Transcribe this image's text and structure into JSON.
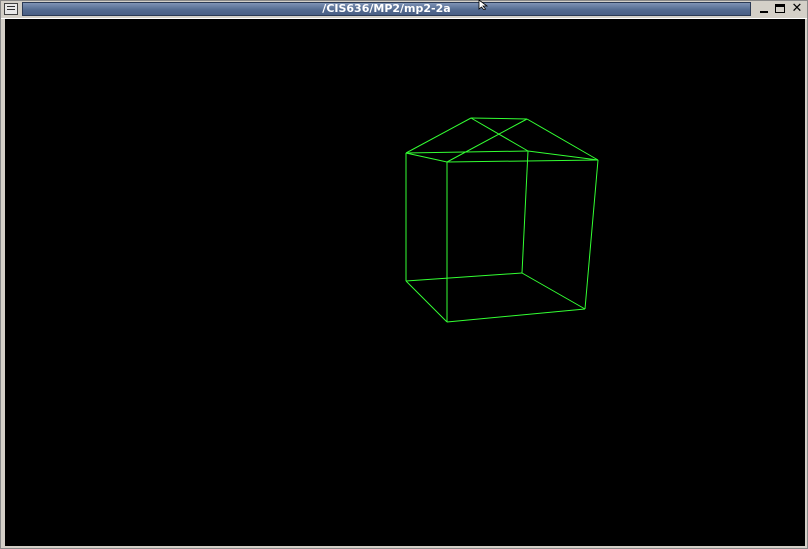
{
  "window": {
    "title": "/CIS636/MP2/mp2-2a",
    "controls": {
      "menu_icon": "window-menu-icon",
      "minimize_icon": "minimize-icon",
      "maximize_icon": "maximize-icon",
      "close_icon": "close-icon",
      "close_glyph": "✕"
    }
  },
  "viewport": {
    "background": "#000000",
    "wire_color": "#33ff33",
    "shape": "wireframe-house"
  }
}
